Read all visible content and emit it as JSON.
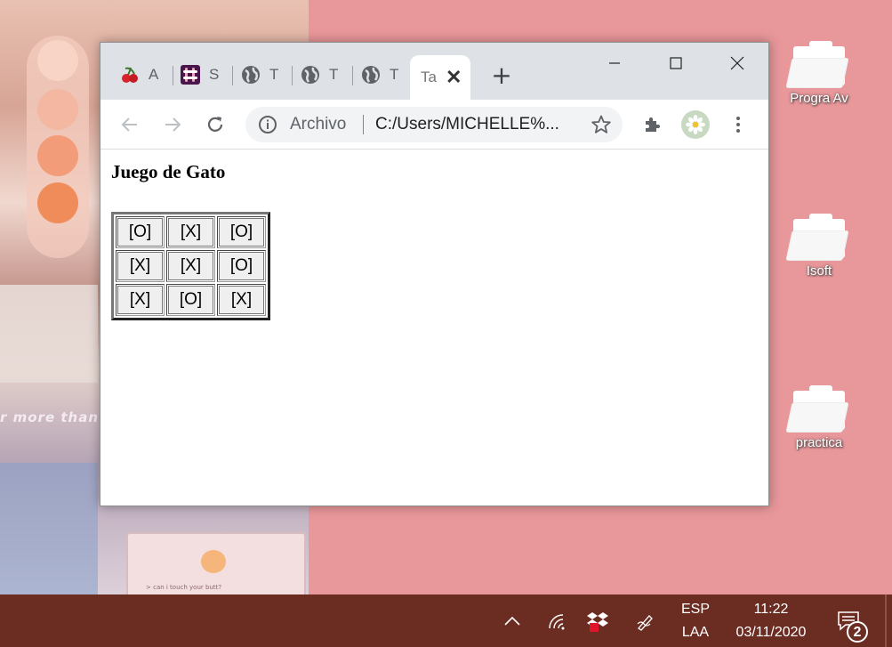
{
  "desktop": {
    "wallpaper_text": "r more than",
    "polaroid_caption": "> can i touch your butt?",
    "icons": [
      {
        "label": "Progra Av"
      },
      {
        "label": "Isoft"
      },
      {
        "label": "practica"
      }
    ]
  },
  "browser": {
    "tabs": [
      {
        "label": "A",
        "icon": "cherry-icon"
      },
      {
        "label": "S",
        "icon": "slack-icon"
      },
      {
        "label": "T",
        "icon": "globe-icon"
      },
      {
        "label": "T",
        "icon": "globe-icon"
      },
      {
        "label": "T",
        "icon": "globe-icon"
      },
      {
        "label": "Ta",
        "icon": "none",
        "active": true
      }
    ],
    "new_tab_label": "+",
    "address": {
      "scheme_label": "Archivo",
      "url": "C:/Users/MICHELLE%..."
    }
  },
  "page": {
    "title": "Juego de Gato",
    "board": [
      [
        "[O]",
        "[X]",
        "[O]"
      ],
      [
        "[X]",
        "[X]",
        "[O]"
      ],
      [
        "[X]",
        "[O]",
        "[X]"
      ]
    ]
  },
  "taskbar": {
    "language": "ESP",
    "layout": "LAA",
    "time": "11:22",
    "date": "03/11/2020",
    "notifications_count": "2"
  },
  "colors": {
    "desktop_background": "#e8979a",
    "taskbar": "#6b2d22",
    "tabstrip": "#dee1e6"
  }
}
